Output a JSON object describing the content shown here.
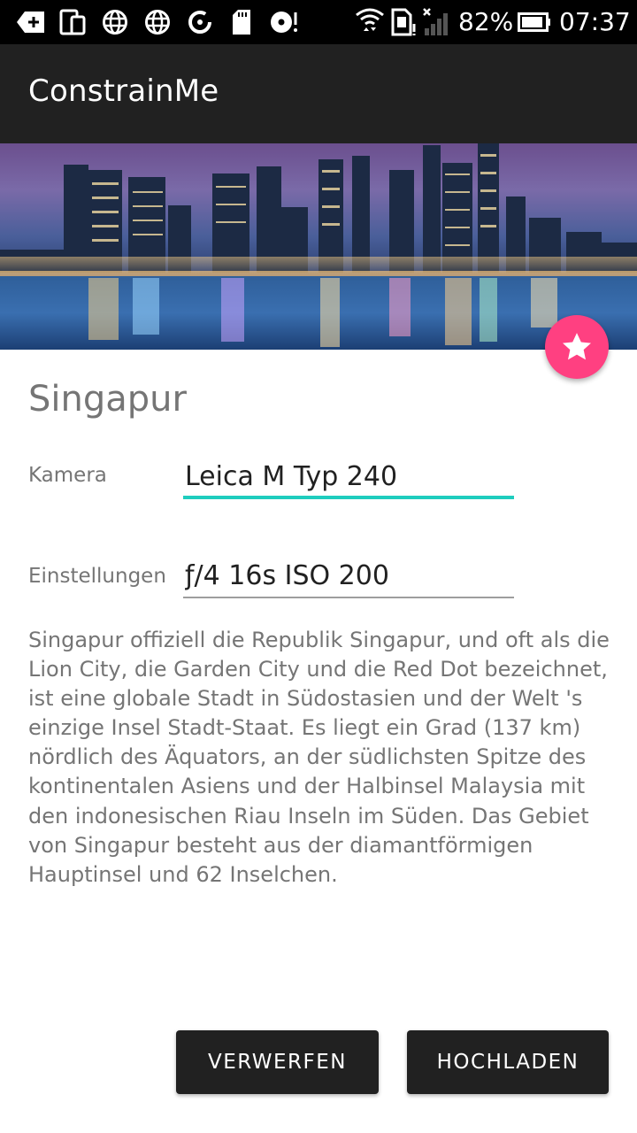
{
  "status_bar": {
    "battery_percent": "82%",
    "time": "07:37",
    "icons": [
      "back-plus-icon",
      "phone-tablet-icon",
      "globe-icon",
      "globe-icon",
      "sync-icon",
      "sd-card-icon",
      "disc-icon",
      "wifi-icon",
      "sim-icon",
      "signal-icon",
      "battery-icon"
    ]
  },
  "app_bar": {
    "title": "ConstrainMe"
  },
  "hero": {
    "image": "singapore-skyline-night-photo"
  },
  "fab": {
    "icon": "star-icon",
    "color": "#ff4081"
  },
  "detail": {
    "title": "Singapur",
    "camera_label": "Kamera",
    "camera_value": "Leica M Typ 240",
    "settings_label": "Einstellungen",
    "settings_value": "ƒ/4 16s ISO 200",
    "description": "Singapur offiziell die Republik Singapur, und oft als die Lion City, die Garden City und die Red Dot bezeichnet, ist eine globale Stadt in Südostasien und der Welt 's einzige Insel Stadt-Staat. Es liegt ein Grad (137 km) nördlich des Äquators, an der südlichsten Spitze des kontinentalen Asiens und der Halbinsel Malaysia mit den indonesischen Riau Inseln im Süden. Das Gebiet von Singapur besteht aus der diamantförmigen Hauptinsel und 62 Inselchen."
  },
  "actions": {
    "discard_label": "VERWERFEN",
    "upload_label": "HOCHLADEN"
  },
  "colors": {
    "accent": "#1fcdbe",
    "app_bar": "#212121",
    "fab": "#ff4081",
    "button": "#212121"
  }
}
